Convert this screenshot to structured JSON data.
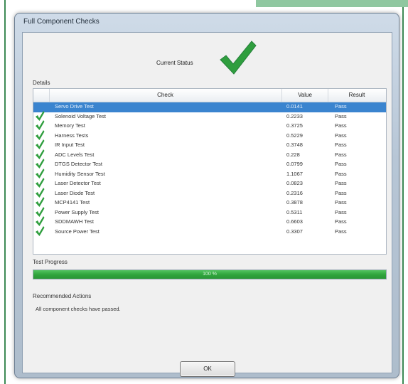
{
  "window": {
    "title": "Full Component Checks"
  },
  "status": {
    "label": "Current Status",
    "icon": "checkmark-icon"
  },
  "details": {
    "label": "Details",
    "columns": [
      "",
      "Check",
      "Value",
      "Result"
    ],
    "rows": [
      {
        "check": "Servo Drive Test",
        "value": "0.0141",
        "result": "Pass",
        "selected": true
      },
      {
        "check": "Solenoid Voltage Test",
        "value": "0.2233",
        "result": "Pass"
      },
      {
        "check": "Memory Test",
        "value": "0.3725",
        "result": "Pass"
      },
      {
        "check": "Harness Tests",
        "value": "0.5229",
        "result": "Pass"
      },
      {
        "check": "IR Input Test",
        "value": "0.3748",
        "result": "Pass"
      },
      {
        "check": "ADC Levels Test",
        "value": "0.228",
        "result": "Pass"
      },
      {
        "check": "DTGS Detector Test",
        "value": "0.0799",
        "result": "Pass"
      },
      {
        "check": "Humidity Sensor Test",
        "value": "1.1067",
        "result": "Pass"
      },
      {
        "check": "Laser Detector Test",
        "value": "0.0823",
        "result": "Pass"
      },
      {
        "check": "Laser Diode Test",
        "value": "0.2316",
        "result": "Pass"
      },
      {
        "check": "MCP4141 Test",
        "value": "0.3878",
        "result": "Pass"
      },
      {
        "check": "Power Supply Test",
        "value": "0.5311",
        "result": "Pass"
      },
      {
        "check": "SDDMAWH Test",
        "value": "0.6603",
        "result": "Pass"
      },
      {
        "check": "Source Power Test",
        "value": "0.3307",
        "result": "Pass"
      }
    ]
  },
  "progress": {
    "label": "Test Progress",
    "value": 1.0,
    "text": "100 %"
  },
  "actions": {
    "label": "Recommended Actions",
    "text": "All component checks have passed."
  },
  "ok_button": {
    "label": "OK"
  },
  "colors": {
    "pass_green": "#2f9e3e",
    "selection_blue": "#3a84cf",
    "progress_green": "#2fa33c"
  }
}
